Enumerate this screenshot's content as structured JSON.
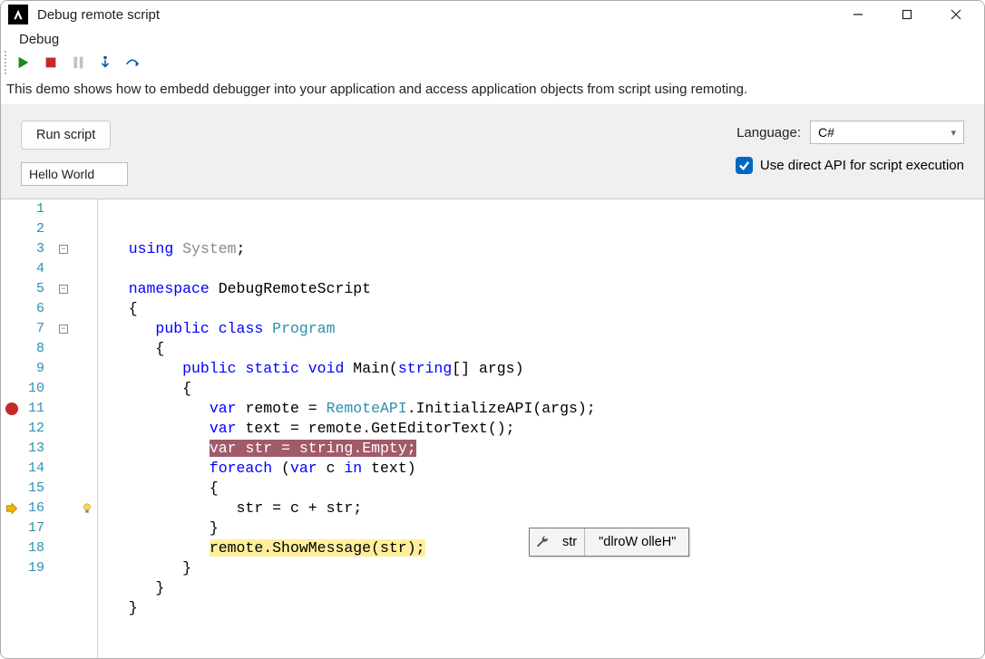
{
  "window": {
    "title": "Debug remote script"
  },
  "menu": {
    "debug": "Debug"
  },
  "info": "This demo shows how to embedd debugger into your application and access application objects from script using remoting.",
  "controls": {
    "run_label": "Run script",
    "text_value": "Hello World",
    "language_label": "Language:",
    "language_value": "C#",
    "direct_api_label": "Use direct API for script execution",
    "direct_api_checked": true
  },
  "toolbar": {
    "start": "Start",
    "stop": "Stop",
    "pause": "Pause",
    "step_into": "Step Into",
    "step_over": "Step Over"
  },
  "tooltip": {
    "var": "str",
    "value": "\"dlroW olleH\""
  },
  "code": {
    "lines": [
      {
        "n": 1,
        "indent": "   ",
        "tokens": [
          [
            "kw",
            "using"
          ],
          [
            "",
            ""
          ],
          [
            "gray",
            " System"
          ],
          [
            "punct",
            ";"
          ]
        ]
      },
      {
        "n": 2,
        "indent": "",
        "tokens": []
      },
      {
        "n": 3,
        "indent": "   ",
        "fold": true,
        "tokens": [
          [
            "kw",
            "namespace"
          ],
          [
            "",
            " "
          ],
          [
            "id",
            "DebugRemoteScript"
          ]
        ]
      },
      {
        "n": 4,
        "indent": "   ",
        "tokens": [
          [
            "punct",
            "{"
          ]
        ],
        "foldline": true
      },
      {
        "n": 5,
        "indent": "      ",
        "fold": true,
        "tokens": [
          [
            "kw",
            "public"
          ],
          [
            "",
            " "
          ],
          [
            "kw",
            "class"
          ],
          [
            "",
            " "
          ],
          [
            "type",
            "Program"
          ]
        ]
      },
      {
        "n": 6,
        "indent": "      ",
        "tokens": [
          [
            "punct",
            "{"
          ]
        ],
        "foldline": true
      },
      {
        "n": 7,
        "indent": "         ",
        "fold": true,
        "tokens": [
          [
            "kw",
            "public"
          ],
          [
            "",
            " "
          ],
          [
            "kw",
            "static"
          ],
          [
            "",
            " "
          ],
          [
            "kw",
            "void"
          ],
          [
            "",
            " "
          ],
          [
            "id",
            "Main"
          ],
          [
            "punct",
            "("
          ],
          [
            "kw",
            "string"
          ],
          [
            "punct",
            "[] "
          ],
          [
            "id",
            "args"
          ],
          [
            "punct",
            ")"
          ]
        ]
      },
      {
        "n": 8,
        "indent": "         ",
        "tokens": [
          [
            "punct",
            "{"
          ]
        ],
        "foldline": true
      },
      {
        "n": 9,
        "indent": "            ",
        "tokens": [
          [
            "kw",
            "var"
          ],
          [
            "",
            " "
          ],
          [
            "id",
            "remote"
          ],
          [
            "",
            " "
          ],
          [
            "punct",
            "="
          ],
          [
            "",
            " "
          ],
          [
            "type",
            "RemoteAPI"
          ],
          [
            "punct",
            "."
          ],
          [
            "id",
            "InitializeAPI"
          ],
          [
            "punct",
            "("
          ],
          [
            "id",
            "args"
          ],
          [
            "punct",
            ");"
          ]
        ],
        "foldline": true
      },
      {
        "n": 10,
        "indent": "            ",
        "tokens": [
          [
            "kw",
            "var"
          ],
          [
            "",
            " "
          ],
          [
            "id",
            "text"
          ],
          [
            "",
            " "
          ],
          [
            "punct",
            "="
          ],
          [
            "",
            " "
          ],
          [
            "id",
            "remote"
          ],
          [
            "punct",
            "."
          ],
          [
            "id",
            "GetEditorText"
          ],
          [
            "punct",
            "();"
          ]
        ],
        "foldline": true
      },
      {
        "n": 11,
        "indent": "            ",
        "breakpoint": true,
        "hl": "bp",
        "tokens": [
          [
            "kw",
            "var"
          ],
          [
            "",
            " "
          ],
          [
            "id",
            "str"
          ],
          [
            "",
            " "
          ],
          [
            "punct",
            "="
          ],
          [
            "",
            " "
          ],
          [
            "kw",
            "string"
          ],
          [
            "punct",
            "."
          ],
          [
            "id",
            "Empty"
          ],
          [
            "punct",
            ";"
          ]
        ],
        "foldline": true
      },
      {
        "n": 12,
        "indent": "            ",
        "tokens": [
          [
            "kw",
            "foreach"
          ],
          [
            "",
            " "
          ],
          [
            "punct",
            "("
          ],
          [
            "kw",
            "var"
          ],
          [
            "",
            " "
          ],
          [
            "id",
            "c"
          ],
          [
            "",
            " "
          ],
          [
            "kw",
            "in"
          ],
          [
            "",
            " "
          ],
          [
            "id",
            "text"
          ],
          [
            "punct",
            ")"
          ]
        ],
        "foldline": true
      },
      {
        "n": 13,
        "indent": "            ",
        "tokens": [
          [
            "punct",
            "{"
          ]
        ],
        "foldline": true
      },
      {
        "n": 14,
        "indent": "               ",
        "tokens": [
          [
            "id",
            "str"
          ],
          [
            "",
            " "
          ],
          [
            "punct",
            "="
          ],
          [
            "",
            " "
          ],
          [
            "id",
            "c"
          ],
          [
            "",
            " "
          ],
          [
            "punct",
            "+"
          ],
          [
            "",
            " "
          ],
          [
            "id",
            "str"
          ],
          [
            "punct",
            ";"
          ]
        ],
        "foldline": true
      },
      {
        "n": 15,
        "indent": "            ",
        "tokens": [
          [
            "punct",
            "}"
          ]
        ],
        "foldline": true
      },
      {
        "n": 16,
        "indent": "            ",
        "current": true,
        "bulb": true,
        "hl": "cur",
        "tokens": [
          [
            "id",
            "remote"
          ],
          [
            "punct",
            "."
          ],
          [
            "id",
            "ShowMessage"
          ],
          [
            "punct",
            "("
          ],
          [
            "id",
            "str"
          ],
          [
            "punct",
            ");"
          ]
        ],
        "foldline": true
      },
      {
        "n": 17,
        "indent": "         ",
        "tokens": [
          [
            "punct",
            "}"
          ]
        ],
        "foldline": true
      },
      {
        "n": 18,
        "indent": "      ",
        "tokens": [
          [
            "punct",
            "}"
          ]
        ],
        "foldline": true
      },
      {
        "n": 19,
        "indent": "   ",
        "tokens": [
          [
            "punct",
            "}"
          ]
        ]
      }
    ]
  }
}
